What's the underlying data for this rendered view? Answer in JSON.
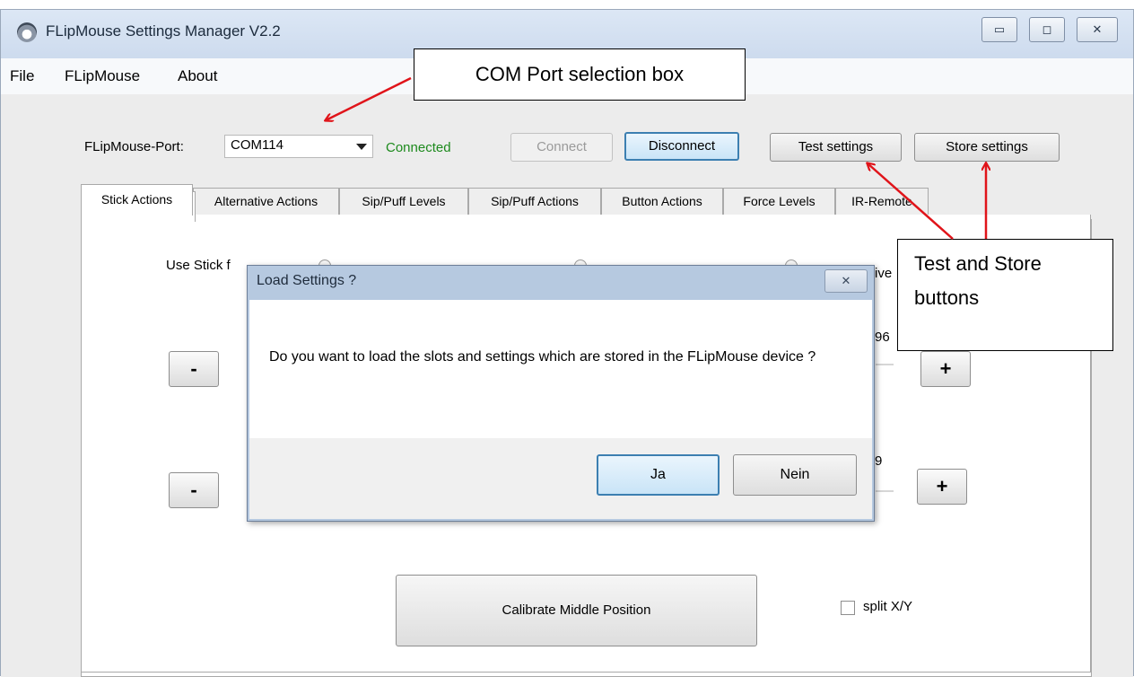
{
  "window": {
    "title": "FLipMouse Settings Manager V2.2",
    "controls": {
      "minimize": "▭",
      "maximize": "◻",
      "close": "✕"
    }
  },
  "menu": [
    "File",
    "FLipMouse",
    "About"
  ],
  "port": {
    "label": "FLipMouse-Port:",
    "selected": "COM114",
    "status": "Connected",
    "status_color": "#1d8a1d"
  },
  "buttons": {
    "connect": "Connect",
    "disconnect": "Disconnect",
    "test": "Test settings",
    "store": "Store settings"
  },
  "tabs": [
    "Stick Actions",
    "Alternative Actions",
    "Sip/Puff Levels",
    "Sip/Puff Actions",
    "Button Actions",
    "Force Levels",
    "IR-Remote"
  ],
  "panel": {
    "use_stick_partial": "Use Stick f",
    "right_partial": "ive",
    "value1_partial": "96",
    "value2_partial": "9",
    "minus": "-",
    "plus": "+",
    "calibrate": "Calibrate Middle Position",
    "split_xy": "split X/Y"
  },
  "dialog": {
    "title": "Load Settings ?",
    "close": "✕",
    "message": "Do you want to load the slots and settings which are stored in the FLipMouse device ?",
    "yes": "Ja",
    "no": "Nein"
  },
  "annotations": {
    "com_port": "COM Port selection box",
    "test_store_line1": "Test and Store",
    "test_store_line2": "buttons",
    "arrow_color": "#e0141a"
  }
}
